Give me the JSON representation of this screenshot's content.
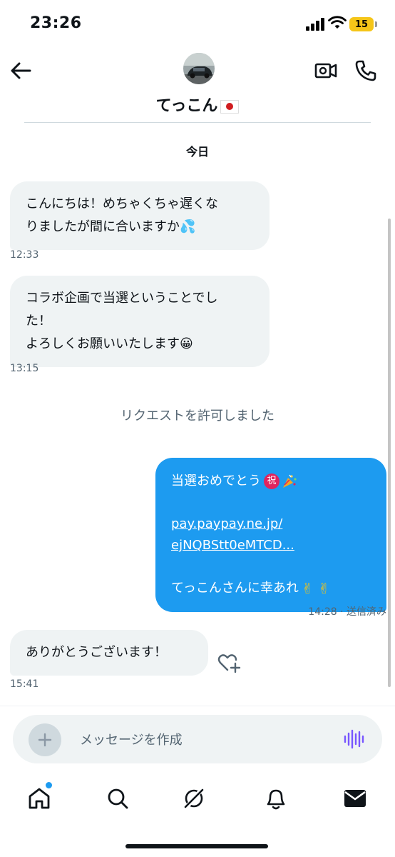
{
  "status_bar": {
    "time": "23:26",
    "battery_level": "15",
    "icons": [
      "signal-icon",
      "wifi-icon",
      "battery-icon"
    ]
  },
  "header": {
    "contact_name": "てっこん",
    "icons": [
      "back-arrow-icon",
      "video-call-icon",
      "phone-icon"
    ]
  },
  "conversation": {
    "date_separator": "今日",
    "incoming_1": {
      "lines": [
        "こんにちは！めちゃくちゃ遅くな",
        "りましたが間に合いますか💦"
      ],
      "time": "12:33"
    },
    "incoming_2": {
      "lines": [
        "コラボ企画で当選ということでし",
        "た！",
        "よろしくお願いいたします😀"
      ],
      "time": "13:15"
    },
    "system_note": "リクエストを許可しました",
    "outgoing_1": {
      "line1": "当選おめでとう",
      "badge": "祝",
      "link_line1": "pay.paypay.ne.jp/",
      "link_line2": "ejNQBStt0eMTCD...",
      "line_last": "てっこんさんに幸あれ",
      "peace_emoji": "✌ ✌",
      "meta": "14:28 · 送信済み"
    },
    "incoming_3": {
      "text": "ありがとうございます！",
      "time": "15:41"
    }
  },
  "composer": {
    "placeholder": "メッセージを作成"
  },
  "nav": {
    "items": [
      "home-icon",
      "search-icon",
      "grok-icon",
      "notifications-icon",
      "messages-icon"
    ],
    "accent": "#1d9bf0"
  },
  "colors": {
    "accent": "#1d9bf0",
    "incoming_bubble": "#eff3f4",
    "secondary_text": "#536471",
    "voice_icon": "#7856ff"
  }
}
